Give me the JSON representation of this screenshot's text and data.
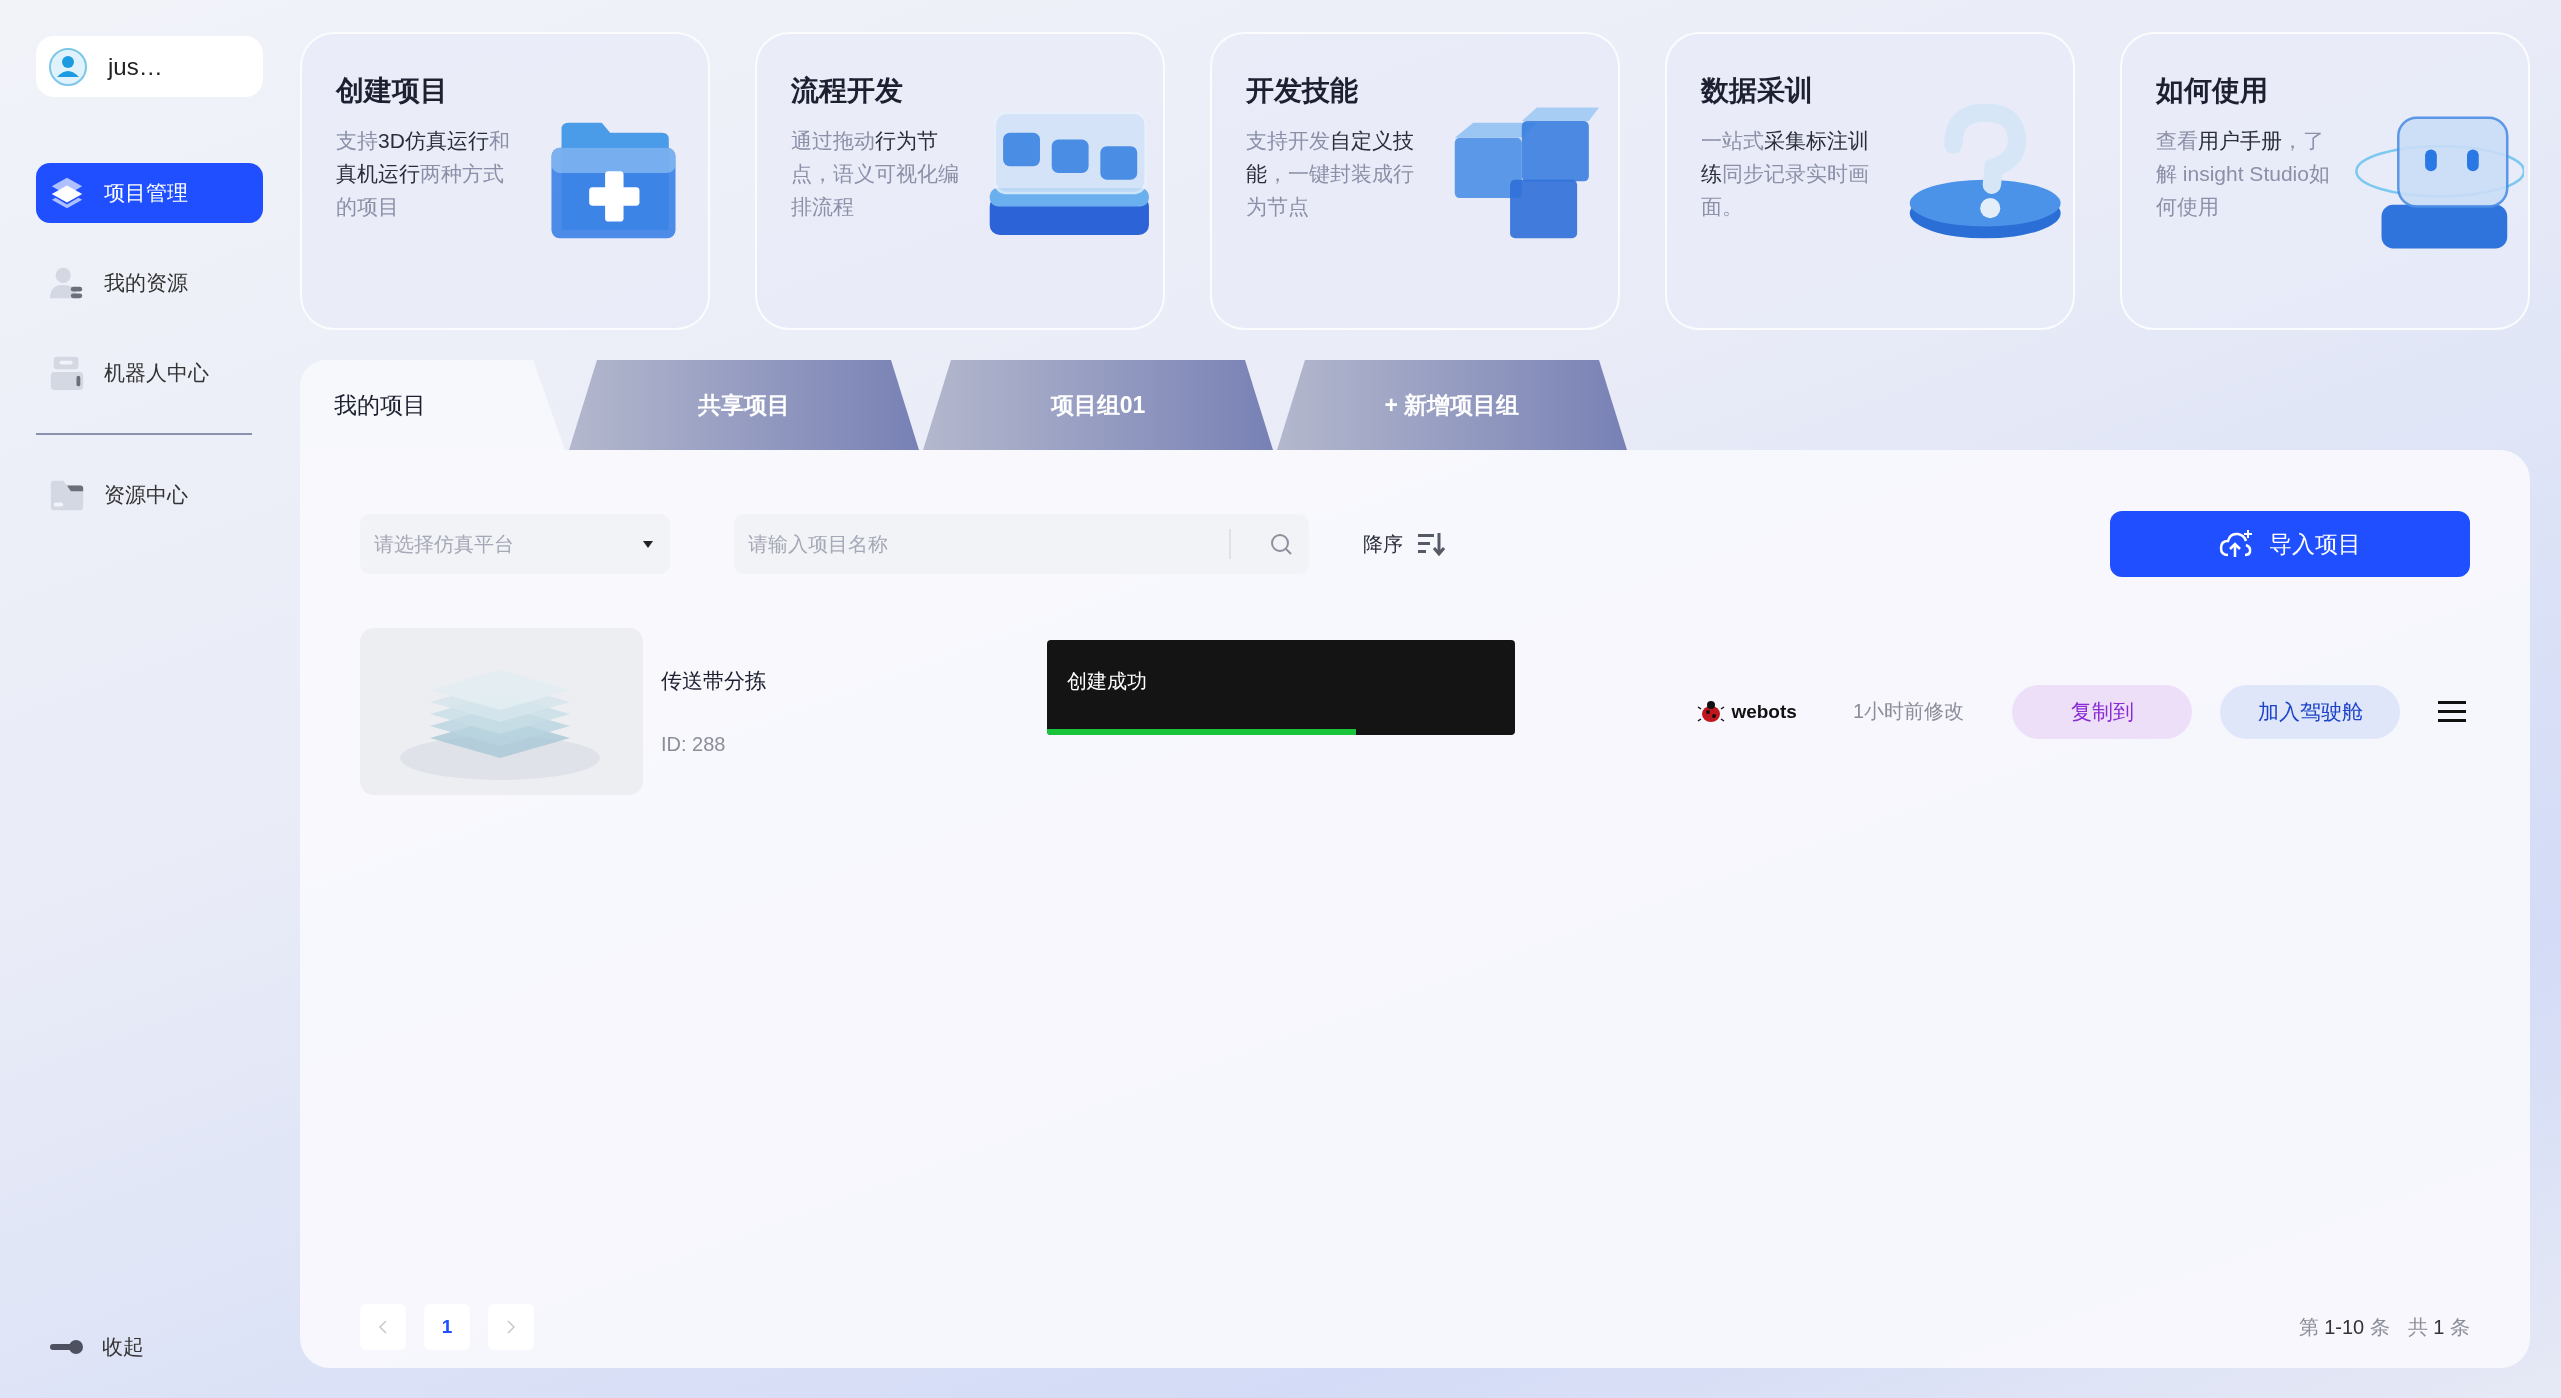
{
  "sidebar": {
    "user": {
      "name": "jus…"
    },
    "nav_groups": [
      [
        {
          "label": "项目管理",
          "selected": true
        },
        {
          "label": "我的资源",
          "selected": false
        },
        {
          "label": "机器人中心",
          "selected": false
        }
      ],
      [
        {
          "label": "资源中心",
          "selected": false
        }
      ]
    ],
    "collapse": {
      "label": "收起"
    }
  },
  "feature_cards": [
    {
      "title": "创建项目",
      "description": [
        {
          "text": "支持",
          "highlight": false
        },
        {
          "text": "3D仿真运行",
          "highlight": true
        },
        {
          "text": "和",
          "highlight": false
        },
        {
          "text": "真机运行",
          "highlight": true
        },
        {
          "text": "两种方式的项目",
          "highlight": false
        }
      ]
    },
    {
      "title": "流程开发",
      "description": [
        {
          "text": "通过拖动",
          "highlight": false
        },
        {
          "text": "行为节",
          "highlight": true
        },
        {
          "text": "点，语义可视化编排流程",
          "highlight": false
        }
      ]
    },
    {
      "title": "开发技能",
      "description": [
        {
          "text": "支持开发",
          "highlight": false
        },
        {
          "text": "自定义技能",
          "highlight": true
        },
        {
          "text": "，一键封装成行为节点",
          "highlight": false
        }
      ]
    },
    {
      "title": "数据采训",
      "description": [
        {
          "text": "一站式",
          "highlight": false
        },
        {
          "text": "采集标注训练",
          "highlight": true
        },
        {
          "text": "同步记录实时画面。",
          "highlight": false
        }
      ]
    },
    {
      "title": "如何使用",
      "description": [
        {
          "text": "查看",
          "highlight": false
        },
        {
          "text": "用户手册",
          "highlight": true
        },
        {
          "text": "，了解 insight Studio如何使用",
          "highlight": false
        }
      ]
    }
  ],
  "tabs": [
    {
      "label": "我的项目",
      "selected": true
    },
    {
      "label": "共享项目",
      "selected": false
    },
    {
      "label": "项目组01",
      "selected": false
    },
    {
      "label": "+ 新增项目组",
      "selected": false
    }
  ],
  "toolbar": {
    "platform_select": {
      "placeholder": "请选择仿真平台"
    },
    "search": {
      "placeholder": "请输入项目名称"
    },
    "sort": {
      "label": "降序"
    },
    "import_button": {
      "label": "导入项目"
    }
  },
  "projects": [
    {
      "title": "传送带分拣",
      "id": "ID: 288",
      "engine": "webots",
      "modified": "1小时前修改",
      "actions": [
        {
          "label": "复制到",
          "kind": "secondary"
        },
        {
          "label": "加入驾驶舱",
          "kind": "primary"
        }
      ]
    }
  ],
  "toast": {
    "message": "创建成功",
    "level": 0.66
  },
  "pagination": {
    "pages": [
      {
        "label": "1",
        "selected": true
      }
    ],
    "range": "第 **1-10** 条",
    "total": "共 **1** 条"
  }
}
